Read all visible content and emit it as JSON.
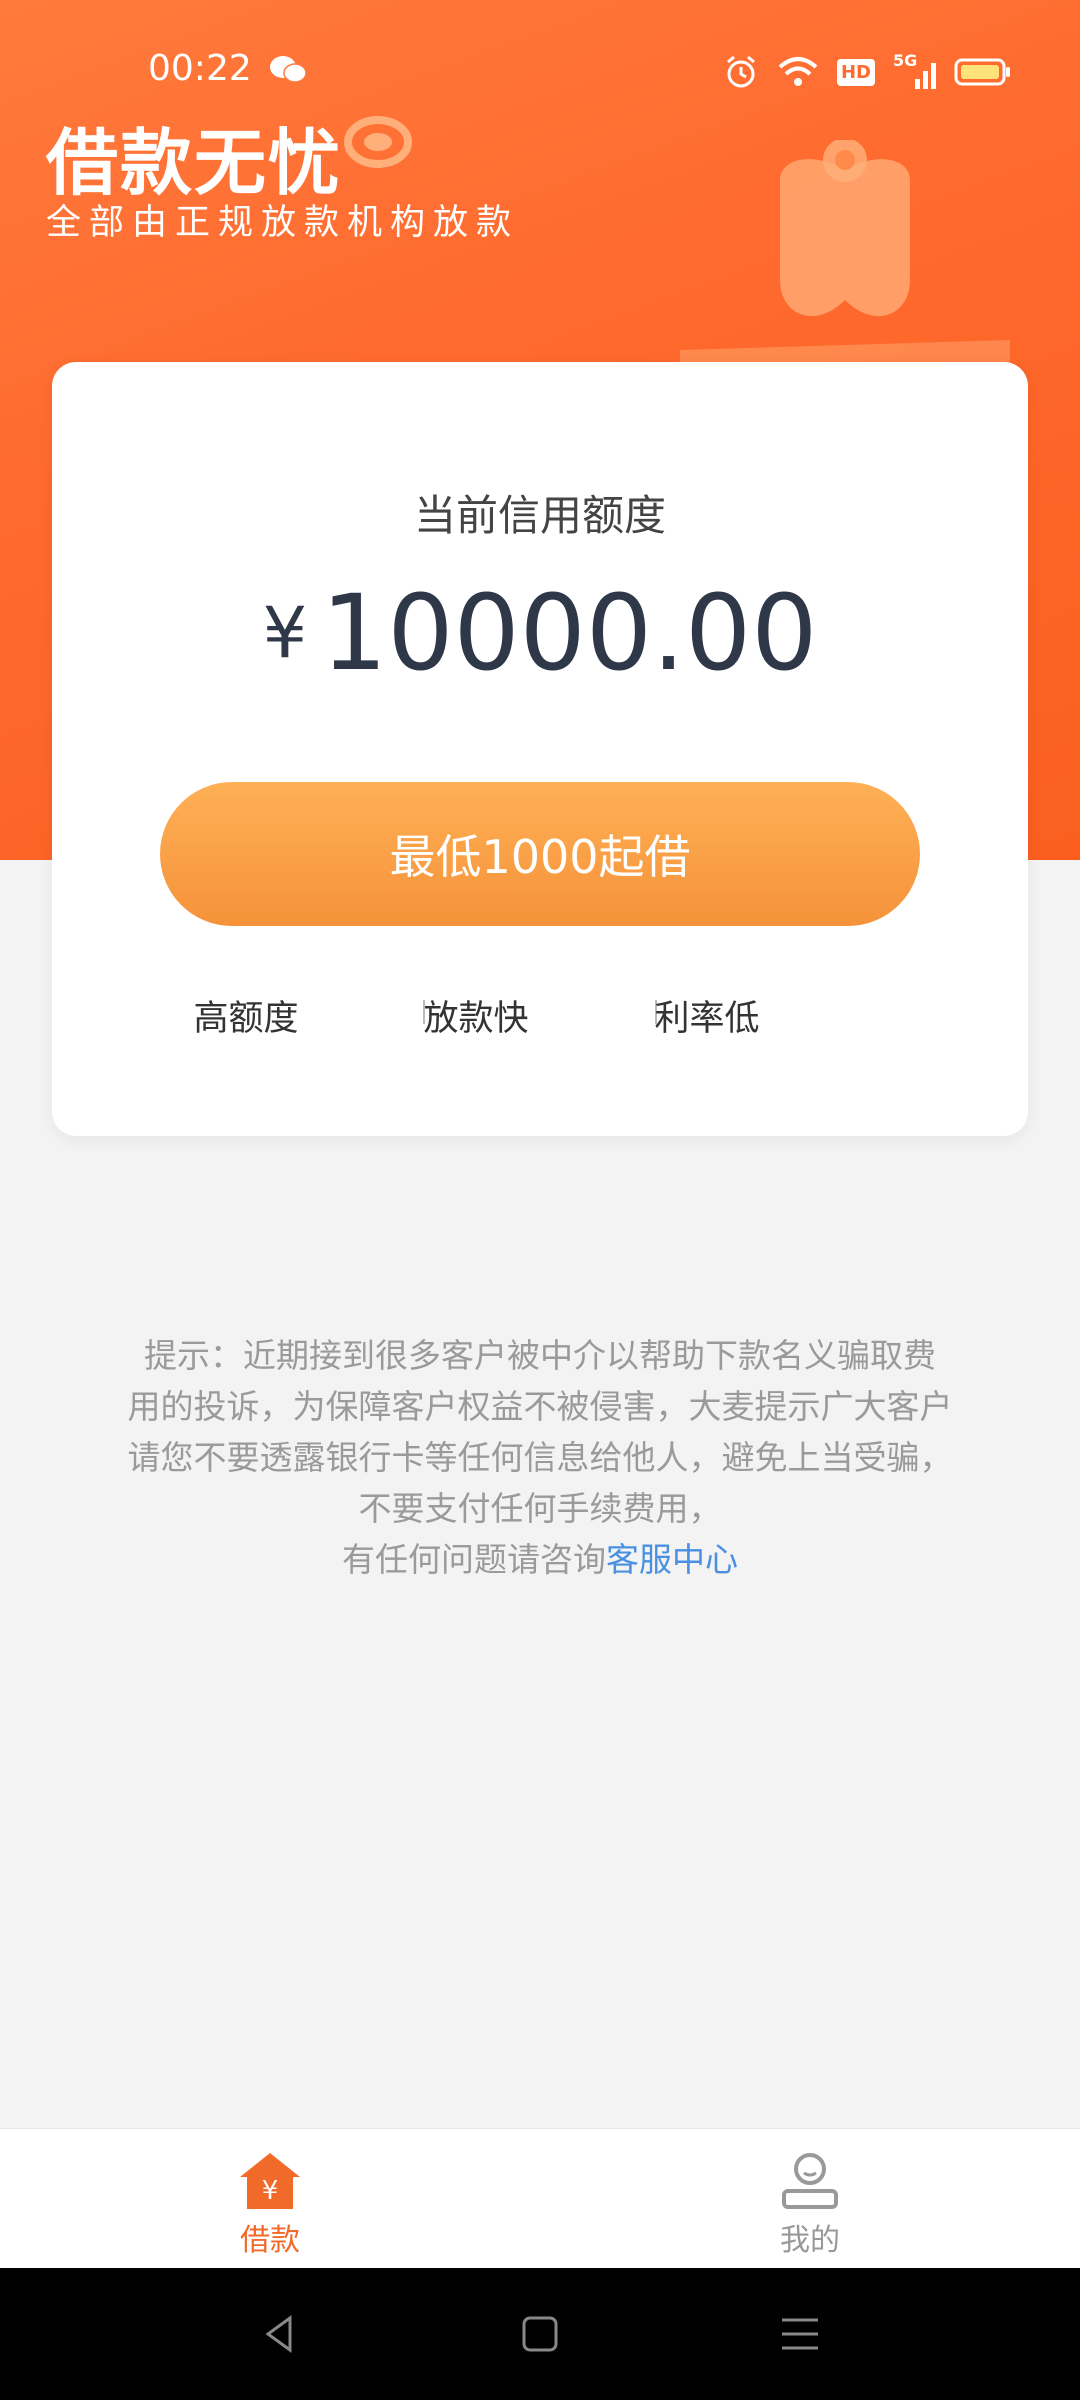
{
  "status_bar": {
    "time": "00:22",
    "network": "5G",
    "hd": "HD"
  },
  "brand": {
    "title": "借款无忧",
    "subtitle": "全部由正规放款机构放款"
  },
  "credit_card": {
    "label": "当前信用额度",
    "currency": "¥",
    "amount": "10000.00",
    "button_label": "最低1000起借",
    "features": [
      "高额度",
      "放款快",
      "利率低"
    ]
  },
  "notice": {
    "lines": [
      "提示：近期接到很多客户被中介以帮助下款名义骗取费",
      "用的投诉，为保障客户权益不被侵害，大麦提示广大客户",
      "请您不要透露银行卡等任何信息给他人，避免上当受骗，",
      "不要支付任何手续费用，"
    ],
    "last_line_prefix": "有任何问题请咨询",
    "link_text": "客服中心"
  },
  "tabbar": {
    "items": [
      {
        "label": "借款",
        "icon": "home-yen-icon",
        "active": true
      },
      {
        "label": "我的",
        "icon": "user-icon",
        "active": false
      }
    ]
  },
  "colors": {
    "accent": "#ff6a2e",
    "button_top": "#ffb055",
    "button_bottom": "#f5923a",
    "link": "#4a90e2",
    "tab_active": "#f26a2a",
    "tab_inactive": "#999999"
  }
}
